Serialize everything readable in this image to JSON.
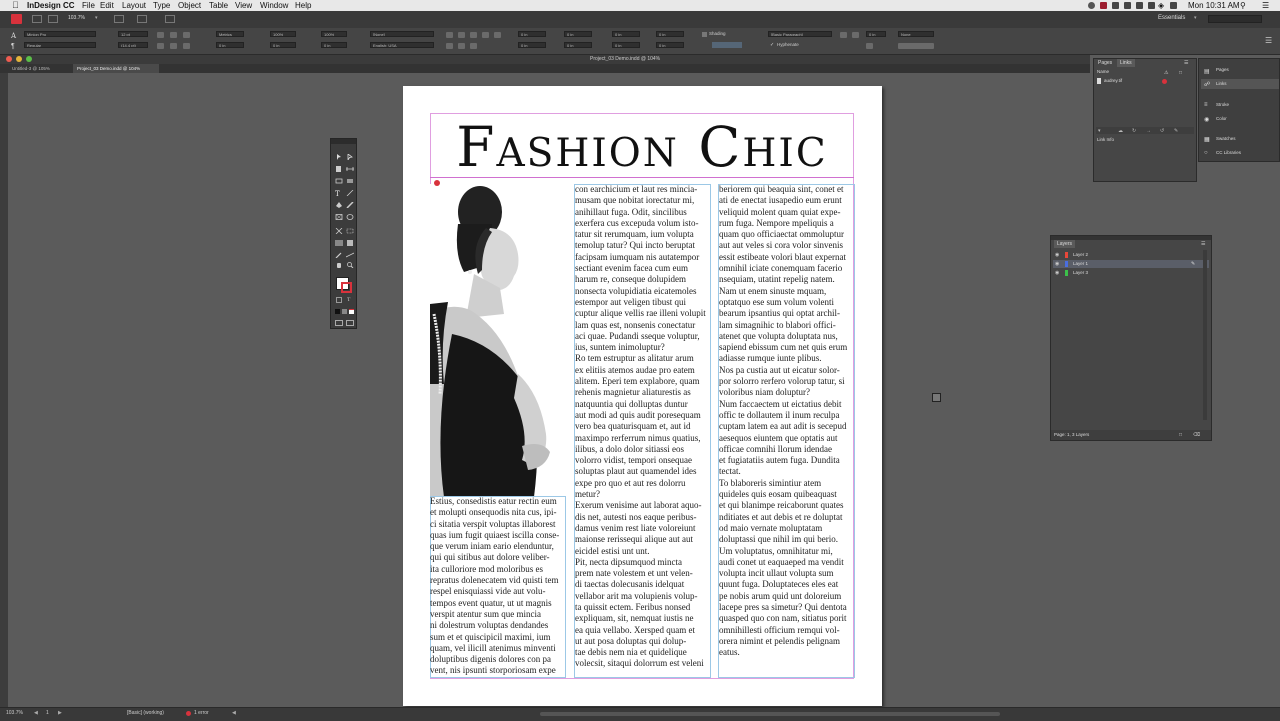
{
  "menubar": {
    "app": "InDesign CC",
    "items": [
      "File",
      "Edit",
      "Layout",
      "Type",
      "Object",
      "Table",
      "View",
      "Window",
      "Help"
    ],
    "clock": "Mon 10:31 AM",
    "workspace": "Essentials"
  },
  "control": {
    "zoom": "103.7%",
    "font_family": "Minion Pro",
    "font_style": "Regular",
    "font_size": "12 pt",
    "leading": "(14.4 pt)",
    "tracking": "Metrics",
    "language": "English: USA",
    "char_style": "[None]",
    "para_style": "[Basic Paragraph]",
    "hyphenate": "Hyphenate",
    "shading": "Shading",
    "stroke_none": "None",
    "measure": "0 in",
    "scale_100": "100%"
  },
  "tabs": {
    "doc1": "Untitled-3 @ 105%",
    "doc2": "Project_03 Demo.indd @ 104%",
    "window_title": "Project_03 Demo.indd @ 104%"
  },
  "page": {
    "headline": "Fashion Chic",
    "col1": "Estius, consedistis eatur rectin eum\net molupti onsequodis nita cus, ipi-\nci sitatia verspit voluptas illaborest\nquas ium fugit quiaest iscilla conse-\nque verum iniam eario elenduntur,\nqui qui sitibus aut dolore veliber-\nita culloriore mod moloribus es\nrepratus dolenecatem vid quisti tem\nrespel enisquiassi vide aut volu-\ntempos event quatur, ut ut magnis\nverspit atentur sum que mincia\nni dolestrum voluptas dendandes\nsum et et quiscipicil maximi, ium\nquam, vel ilicill atenimus minventi\ndoluptibus digenis dolores con pa\nvent, nis ipsunti storporiosam expe",
    "col2": "con earchicium et laut res mincia-\nmusam que nobitat iorectatur mi,\nanihillaut fuga. Odit, sincilibus\nexerfera cus excepuda volum isto-\ntatur sit rerumquam, ium volupta\ntemolup tatur? Qui incto beruptat\nfacipsam iumquam nis autatempor\nsectiant evenim facea cum eum\nharum re, conseque dolupidem\nnonsecta volupidiatia eicatemoles\nestempor aut veligen tibust qui\ncuptur alique vellis rae illeni volupit\nlam quas est, nonsenis conectatur\naci quae. Pudandi sseque voluptur,\nius, suntem inimoluptur?\nRo tem estruptur as alitatur arum\nex elitiis atemos audae pro eatem\nalitem. Eperi tem explabore, quam\nrehenis magnietur aliaturestis as\nnatquuntia qui dolluptas duntur\naut modi ad quis audit poresequam\nvero bea quaturisquam et, aut id\nmaximpo rerferrum nimus quatius,\nilibus, a dolo dolor sitiassi eos\nvolorro vidist, tempori onsequae\nsoluptas plaut aut quamendel ides\nexpe pro quo et aut res dolorru\nmetur?\nExerum venisime aut laborat aquo-\ndis net, autesti nos eaque peribus-\ndamus venim rest liate voloreiunt\nmaionse rerissequi alique aut aut\neicidel estisi unt unt.\nPit, necta dipsumquod mincta\nprem nate volestem et unt velen-\ndi taectas dolecusanis idelquat\nvellabor arit ma volupienis volup-\nta quissit ectem. Feribus nonsed\nexpliquam, sit, nemquat iustis ne\nea quia vellabo. Xersped quam et\nut aut posa doluptas qui dolup-\ntae debis nem nia et quidelique\nvolecsit, sitaqui dolorrum est veleni",
    "col3": "beriorem qui beaquia sint, conet et\nati de enectat iusapedio eum erunt\nveliquid molent quam quiat expe-\nrum fuga. Nempore mpeliquis a\nquam quo officiaectat ommoluptur\naut aut veles si cora volor sinvenis\nessit estibeate volori blaut expernat\nomnihil iciate conemquam facerio\nnsequiam, utatint repelig natem.\nNam ut enem sinuste mquam,\noptatquo ese sum volum volenti\nbearum ipsantius qui optat archil-\nlam simagnihic to blabori offici-\natenet que volupta doluptata nus,\nsapiend ebissum cum net quis erum\nadiasse rumque iunte plibus.\nNos pa custia aut ut eicatur solor-\npor solorro rerfero volorup tatur, si\nvoloribus niam doluptur?\nNum faccaectem ut eictatius debit\noffic te dollautem il inum reculpa\ncuptam latem ea aut adit is secepud\naesequos eiuntem que optatis aut\nofficae comnihi llorum idendae\net fugiatatiis autem fuga. Dundita\ntectat.\nTo blaboreris simintiur atem\nquideles quis eosam quibeaquast\net qui blanimpe reicaborunt quates\nnditiates et aut debis et re doluptat\nod maio vernate moluptatam\ndoluptassi que nihil im qui berio.\nUm voluptatus, omnihitatur mi,\naudi conet ut eaquaeped ma vendit\nvolupta incit ullaut volupta sum\nquunt fuga. Doluptateces eles eat\npe nobis arum quid unt doloreium\nlacepe pres sa simetur? Qui dentota\nquasped quo con nam, sitiatus porit\nomnihillesti officium remqui vol-\norera nimint et pelendis pelignam\neatus."
  },
  "links_panel": {
    "tab_pages": "Pages",
    "tab_links": "Links",
    "col_name": "Name",
    "file": "audrey.tif",
    "link_info": "Link Info"
  },
  "dock": {
    "items": [
      "Pages",
      "Links",
      "Stroke",
      "Color",
      "Swatches",
      "CC Libraries"
    ]
  },
  "layers_panel": {
    "title": "Layers",
    "layers": [
      {
        "name": "Layer 2",
        "color": "#e8473a"
      },
      {
        "name": "Layer 1",
        "color": "#4a6ee0"
      },
      {
        "name": "Layer 3",
        "color": "#3cc04a"
      }
    ],
    "footer": "Page: 1, 3 Layers"
  },
  "status": {
    "zoom": "103.7%",
    "page": "1",
    "style": "[Basic] (working)",
    "errors": "1 error"
  },
  "colors": {
    "accent": "#2f6bd6",
    "error": "#d8323c",
    "margin": "#e09ee0"
  }
}
